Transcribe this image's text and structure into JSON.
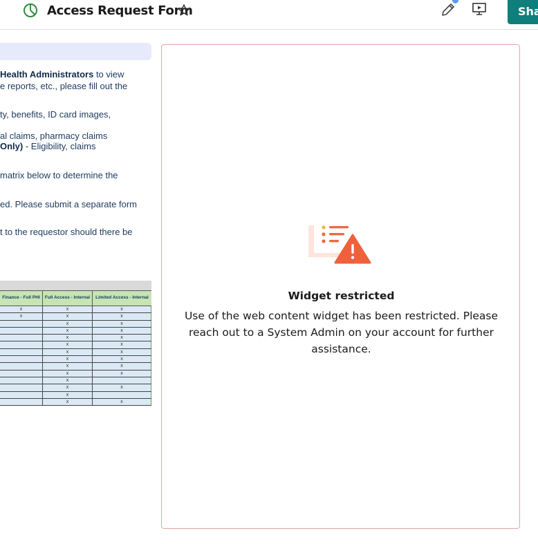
{
  "header": {
    "title": "Access Request Form",
    "share_label": "Sha"
  },
  "icons": {
    "app": "pie-chart-icon",
    "favorite": "star-icon",
    "edit": "pencil-icon",
    "present": "present-icon",
    "warning": "warning-icon"
  },
  "colors": {
    "accent": "#0e7f7a",
    "app_icon": "#2e8b3a",
    "warning": "#f06a3f",
    "widget_border": "#e2a6a6",
    "matrix_header": "#c7e4b4",
    "matrix_row": "#dbe9f5"
  },
  "document": {
    "lines": [
      {
        "bold": "Health Administrators",
        "text": " to view"
      },
      {
        "bold": "",
        "text": "e reports, etc., please fill out the"
      },
      {
        "bold": "",
        "text": "ty, benefits, ID card images,"
      },
      {
        "bold": "",
        "text": "al claims, pharmacy claims"
      },
      {
        "bold": "Only)",
        "text": " - Eligibility, claims"
      },
      {
        "bold": "",
        "text": " matrix below to determine the"
      },
      {
        "bold": "",
        "text": "ed. Please submit a separate form"
      },
      {
        "bold": "",
        "text": "t to the requestor should there be"
      }
    ],
    "matrix": {
      "headers": [
        "Finance - Full PHI",
        "Full Access - Internal",
        "Limited Access - Internal"
      ],
      "rows": [
        [
          "x",
          "x",
          "x"
        ],
        [
          "x",
          "x",
          "x"
        ],
        [
          "",
          "x",
          "x"
        ],
        [
          "",
          "x",
          "x"
        ],
        [
          "",
          "x",
          "x"
        ],
        [
          "",
          "x",
          "x"
        ],
        [
          "",
          "x",
          "x"
        ],
        [
          "",
          "x",
          "x"
        ],
        [
          "",
          "x",
          "x"
        ],
        [
          "",
          "x",
          "x"
        ],
        [
          "",
          "x",
          ""
        ],
        [
          "",
          "x",
          "x"
        ],
        [
          "",
          "x",
          ""
        ],
        [
          "",
          "x",
          "x"
        ]
      ]
    }
  },
  "restricted_widget": {
    "title": "Widget restricted",
    "message": "Use of the web content widget has been restricted. Please reach out to a System Admin on your account for further assistance."
  }
}
